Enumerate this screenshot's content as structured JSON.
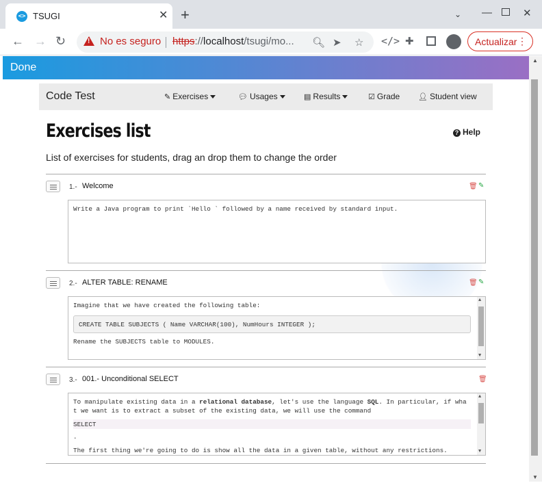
{
  "browser": {
    "tab_title": "TSUGI",
    "tab_favicon": "<>",
    "security_label": "No es seguro",
    "url_scheme": "https",
    "url_sep": "://",
    "url_host": "localhost",
    "url_path": "/tsugi/mo...",
    "update_label": "Actualizar",
    "icons": {
      "back": "arrow-left",
      "forward": "arrow-right",
      "reload": "reload",
      "zoom": "magnifier",
      "send": "paper-plane",
      "star": "star",
      "devtools": "code",
      "extensions": "puzzle",
      "sidepanel": "sidepanel",
      "profile": "person",
      "menu": "vertical-dots"
    }
  },
  "done_label": "Done",
  "navbar": {
    "brand": "Code Test",
    "items": [
      {
        "label": "Exercises",
        "icon": "edit"
      },
      {
        "label": "Usages",
        "icon": "comments"
      },
      {
        "label": "Results",
        "icon": "list"
      },
      {
        "label": "Grade",
        "icon": "clipboard-check"
      },
      {
        "label": "Student view",
        "icon": "user"
      }
    ]
  },
  "page": {
    "title": "Exercises list",
    "help_label": "Help",
    "subtitle": "List of exercises for students, drag an drop them to change the order"
  },
  "exercises": [
    {
      "number": "1.-",
      "title": "Welcome",
      "lines": [
        "Write a Java program to print `Hello ` followed by a name received by standard input."
      ]
    },
    {
      "number": "2.-",
      "title": "ALTER TABLE: RENAME",
      "intro": "Imagine that we have created the following table:",
      "code": "CREATE TABLE SUBJECTS ( Name VARCHAR(100), NumHours INTEGER );",
      "after": "Rename the SUBJECTS table to MODULES."
    },
    {
      "number": "3.-",
      "title": "001.- Unconditional SELECT",
      "p1_a": "To manipulate existing data in a ",
      "p1_b": "relational database",
      "p1_c": ", let's use the language ",
      "p1_d": "SQL",
      "p1_e": ". In particular, if wha",
      "p1_line2": "t we want is to extract a subset of the existing data, we will use the command",
      "code": "SELECT",
      "dot": ".",
      "p2": "The first thing we're going to do is show all the data in a given table, without any restrictions."
    }
  ],
  "colors": {
    "accent_start": "#1a9be0",
    "accent_end": "#9a6fc4",
    "danger": "#d9534f",
    "success": "#28a745"
  }
}
